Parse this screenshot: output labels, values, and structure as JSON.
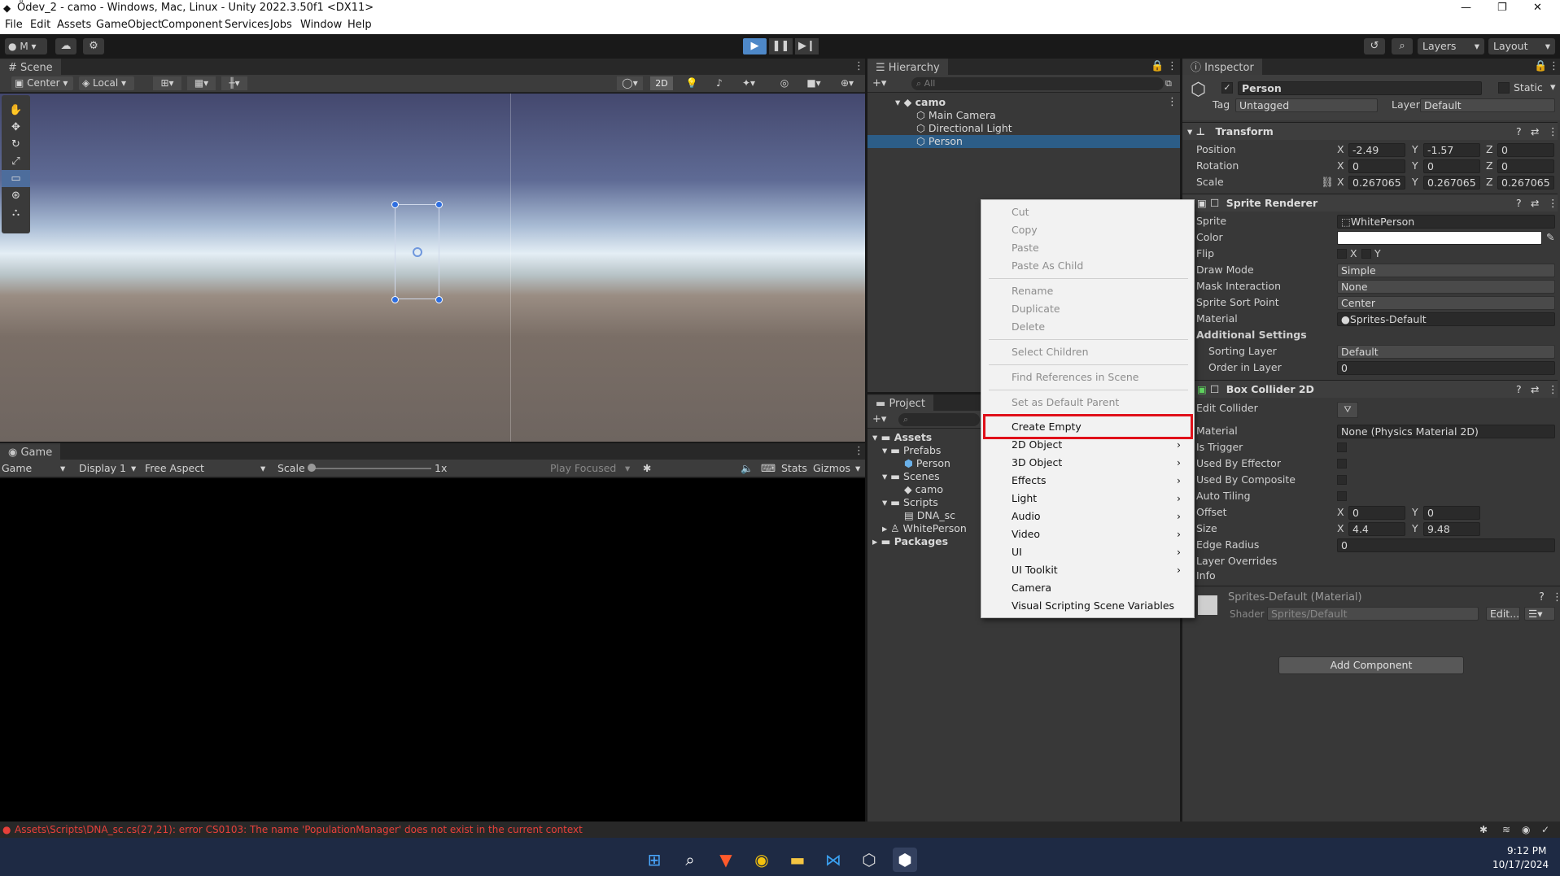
{
  "window": {
    "title": "Ödev_2 - camo - Windows, Mac, Linux - Unity 2022.3.50f1 <DX11>"
  },
  "menu": [
    "File",
    "Edit",
    "Assets",
    "GameObject",
    "Component",
    "Services",
    "Jobs",
    "Window",
    "Help"
  ],
  "toolbar": {
    "account": "M",
    "layers": "Layers",
    "layout": "Layout"
  },
  "scene": {
    "tab": "Scene",
    "pivot": "Center",
    "space": "Local",
    "mode2d": "2D"
  },
  "game": {
    "tab": "Game",
    "view": "Game",
    "display": "Display 1",
    "aspect": "Free Aspect",
    "scale_label": "Scale",
    "scale_value": "1x",
    "play_focused": "Play Focused",
    "stats": "Stats",
    "gizmos": "Gizmos"
  },
  "hierarchy": {
    "tab": "Hierarchy",
    "search_placeholder": "All",
    "scene": "camo",
    "items": [
      "Main Camera",
      "Directional Light",
      "Person"
    ]
  },
  "project": {
    "tab": "Project",
    "tree": [
      "Assets",
      "Prefabs",
      "Person",
      "Scenes",
      "camo",
      "Scripts",
      "DNA_sc",
      "WhitePerson",
      "Packages"
    ]
  },
  "context_menu": {
    "cut": "Cut",
    "copy": "Copy",
    "paste": "Paste",
    "paste_child": "Paste As Child",
    "rename": "Rename",
    "duplicate": "Duplicate",
    "delete": "Delete",
    "select_children": "Select Children",
    "find_refs": "Find References in Scene",
    "set_default_parent": "Set as Default Parent",
    "create_empty": "Create Empty",
    "obj2d": "2D Object",
    "obj3d": "3D Object",
    "effects": "Effects",
    "light": "Light",
    "audio": "Audio",
    "video": "Video",
    "ui": "UI",
    "ui_toolkit": "UI Toolkit",
    "camera": "Camera",
    "vs_vars": "Visual Scripting Scene Variables",
    "highlight_color": "#e0101a"
  },
  "inspector": {
    "tab": "Inspector",
    "object_name": "Person",
    "static": "Static",
    "tag_label": "Tag",
    "tag": "Untagged",
    "layer_label": "Layer",
    "layer": "Default",
    "transform": {
      "title": "Transform",
      "pos_label": "Position",
      "rot_label": "Rotation",
      "scale_label": "Scale",
      "pos": [
        "-2.49",
        "-1.57",
        "0"
      ],
      "rot": [
        "0",
        "0",
        "0"
      ],
      "scale": [
        "0.267065",
        "0.267065",
        "0.267065"
      ],
      "x": "X",
      "y": "Y",
      "z": "Z"
    },
    "sprite_renderer": {
      "title": "Sprite Renderer",
      "sprite_label": "Sprite",
      "sprite": "WhitePerson",
      "color_label": "Color",
      "flip_label": "Flip",
      "flip_x": "X",
      "flip_y": "Y",
      "draw_mode_label": "Draw Mode",
      "draw_mode": "Simple",
      "mask_label": "Mask Interaction",
      "mask": "None",
      "sort_point_label": "Sprite Sort Point",
      "sort_point": "Center",
      "material_label": "Material",
      "material": "Sprites-Default",
      "additional": "Additional Settings",
      "sorting_layer_label": "Sorting Layer",
      "sorting_layer": "Default",
      "order_label": "Order in Layer",
      "order": "0"
    },
    "box_collider": {
      "title": "Box Collider 2D",
      "edit_label": "Edit Collider",
      "material_label": "Material",
      "material": "None (Physics Material 2D)",
      "trigger": "Is Trigger",
      "effector": "Used By Effector",
      "composite": "Used By Composite",
      "tiling": "Auto Tiling",
      "offset_label": "Offset",
      "offset": [
        "0",
        "0"
      ],
      "size_label": "Size",
      "size": [
        "4.4",
        "9.48"
      ],
      "edge_label": "Edge Radius",
      "edge": "0",
      "overrides": "Layer Overrides",
      "info": "Info"
    },
    "material": {
      "title": "Sprites-Default (Material)",
      "shader_label": "Shader",
      "shader": "Sprites/Default",
      "edit": "Edit..."
    },
    "add_component": "Add Component"
  },
  "console": {
    "error": "Assets\\Scripts\\DNA_sc.cs(27,21): error CS0103: The name 'PopulationManager' does not exist in the current context",
    "color": "#e8403a"
  },
  "taskbar": {
    "time": "9:12 PM",
    "date": "10/17/2024"
  }
}
